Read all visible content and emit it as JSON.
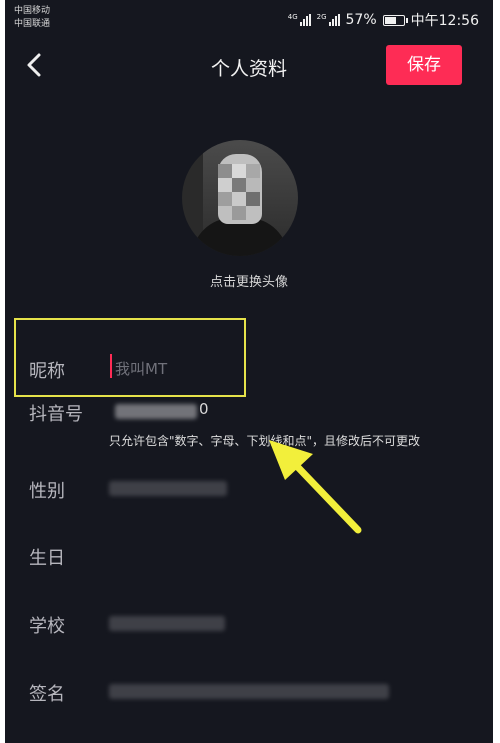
{
  "status_bar": {
    "carrier_1": "中国移动",
    "carrier_2": "中国联通",
    "sig1_tag": "4G",
    "sig2_tag": "2G",
    "battery_percent": "57%",
    "time": "中午12:56"
  },
  "header": {
    "title": "个人资料",
    "save_label": "保存"
  },
  "avatar": {
    "hint": "点击更换头像"
  },
  "form": {
    "nickname": {
      "label": "昵称",
      "value": "我叫MT"
    },
    "douyin_id": {
      "label": "抖音号",
      "value_suffix": "0",
      "hint": "只允许包含\"数字、字母、下划线和点\"，且修改后不可更改"
    },
    "gender": {
      "label": "性别"
    },
    "birthday": {
      "label": "生日"
    },
    "school": {
      "label": "学校"
    },
    "signature": {
      "label": "签名"
    }
  },
  "colors": {
    "background": "#15171f",
    "accent": "#fe2c55",
    "annotation": "#e6e34a"
  }
}
